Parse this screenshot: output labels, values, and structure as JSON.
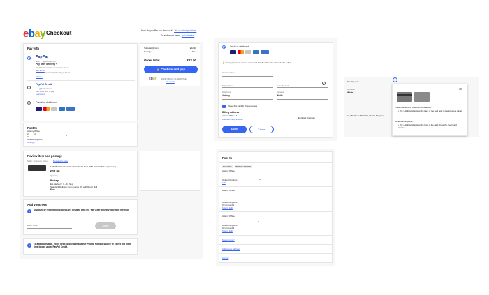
{
  "header": {
    "logo": "ebay",
    "title": "Checkout",
    "feedback_q": "How do you like our checkout?",
    "feedback_link": "Tell us what you think",
    "add_more": "To add more items,",
    "cart_link": "go to basket"
  },
  "pay_with": {
    "title": "Pay with",
    "paypal_label": "PayPal",
    "paypal_email": "anto*****@hotmail.com",
    "pay_after": "Pay after delivery +",
    "pay_after_sub": "PayPal will start the new trial on 8 Sep",
    "pay_after_link": "See terms",
    "pay_after_note": "This is doesn't work, PayPal will get this for",
    "change_link": "Change",
    "paypal_credit": "PayPal Credit",
    "credit_email": "@hotmail.com",
    "credit_note": "See more how to pay",
    "credit_link": "Learn more",
    "card_label": "Credit or debit card"
  },
  "post_to": {
    "title": "Post to",
    "name": "Antony White",
    "line1": "2",
    "line2": "4",
    "city": "4",
    "postcode": "3",
    "country": "United Kingdom",
    "change_link": "Change"
  },
  "review": {
    "title": "Review item and postage",
    "seller_label": "Seller: rockmoon_store",
    "seller_link": "Message to seller",
    "item_title": "128GB 4Disk Dual Drive Elite S101 Pro USB3.0 Flash Drive (Titanium)",
    "price": "£22.90",
    "qty": "Quantity 1",
    "postage_title": "Postage",
    "delivery": "Est. delivery: 7 – 15 Sep",
    "service": "Standard Delivery from outside UK with Royal Mail",
    "free": "Free"
  },
  "vouchers": {
    "title": "Add vouchers",
    "note": "Discount or redemption codes can't be used with the 'Pay After delivery' payment method.",
    "placeholder": "Enter code",
    "apply": "Apply"
  },
  "donation": {
    "note": "To add a donation, you'll need to pay with another PayPal funding source or select Get more time to pay under PayPal Credit."
  },
  "summary": {
    "subtotal_label": "Subtotal (1 item)",
    "subtotal": "£22.90",
    "postage_label": "Postage",
    "postage": "Free",
    "total_label": "Order total",
    "total": "£22.90",
    "confirm": "Confirm and pay",
    "guarantee": "MONEY BACK GUARANTEE",
    "guarantee_link": "See details"
  },
  "card_form": {
    "title": "Credit or debit card",
    "secure": "Your payment is secure. Your card details will not be shared with sellers.",
    "card_number": "Card number",
    "expiry": "Expiry date",
    "security": "Security code",
    "first_label": "First name",
    "first": "Antony",
    "surname_label": "Surname",
    "surname": "White",
    "save": "Save this card for future orders",
    "billing_title": "Billing address",
    "billing": "Antony White, 4",
    "billing_country": "IE United Kingdom",
    "billing_link": "Add new billing address",
    "done": "Done",
    "cancel": "Cancel"
  },
  "security_popover": {
    "field_label": "Security code",
    "surname_label": "Surname",
    "surname": "White",
    "address": "rn, Middlesex TW13JF, United Kingdom",
    "visa_title": "Visa, Mastercard, Discover or Maestro:",
    "visa_bullet": "The 3-digit number is on the back of the card next to the signature panel.",
    "amex_title": "American Express:",
    "amex_bullet": "The 4-digit number is on the front of the card above the credit card number."
  },
  "post_list": {
    "title": "Post to",
    "selected": "SELECTED",
    "primary": "PRIMARY ADDRESS",
    "entries": [
      {
        "name": "Antony White",
        "country": "United Kingdom",
        "phone": "",
        "link": "Edit",
        "num": "4"
      },
      {
        "name": "Antony White",
        "country": "United Kingdom",
        "phone": "07xxxxxxx41",
        "link": "Select | Edit",
        "num": ""
      },
      {
        "name": "Antony White",
        "country": "United Kingdom",
        "phone": "07xxxxxxx33",
        "link": "Select | Edit",
        "num": "3"
      }
    ],
    "show_more": "Show more",
    "add_new": "Add a new address",
    "cancel": "Cancel"
  },
  "colors": {
    "ebay_e": "#e53238",
    "ebay_b": "#0064d2",
    "ebay_a": "#f5af02",
    "ebay_y": "#86b817",
    "accent": "#3665f3"
  }
}
